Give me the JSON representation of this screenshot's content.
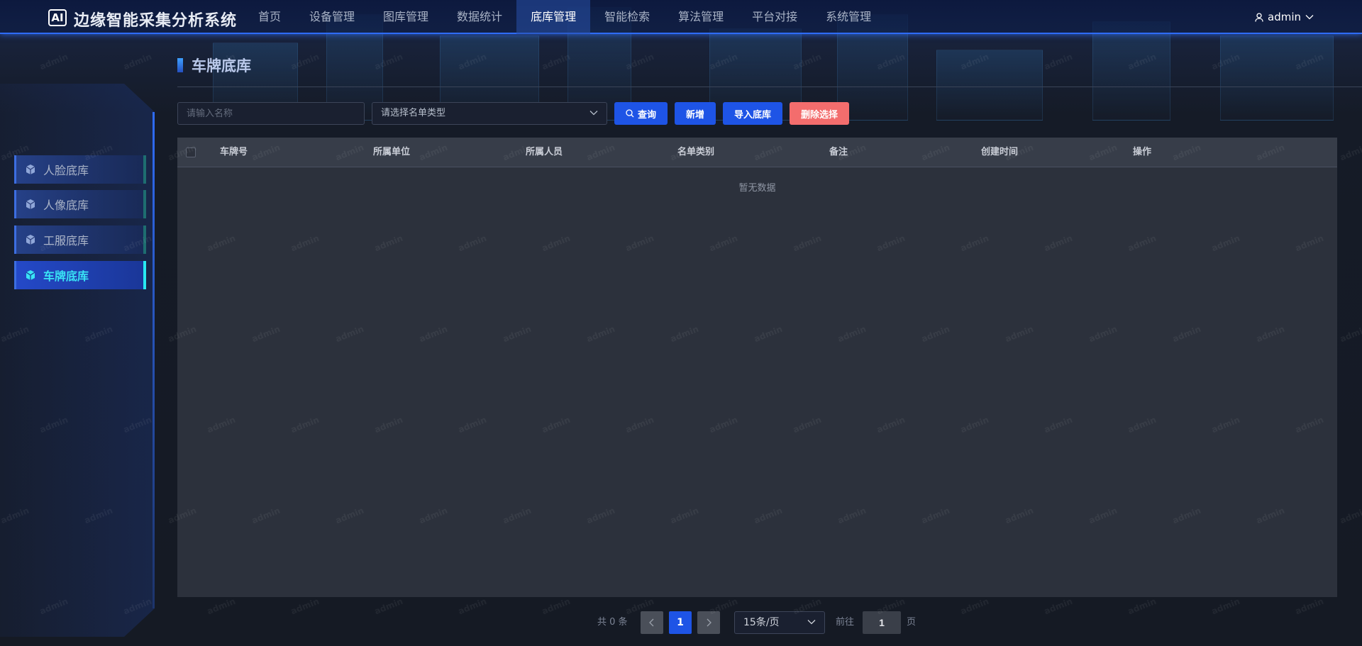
{
  "header": {
    "logo_text": "AI",
    "app_title": "边缘智能采集分析系统",
    "nav": [
      {
        "label": "首页",
        "active": false
      },
      {
        "label": "设备管理",
        "active": false
      },
      {
        "label": "图库管理",
        "active": false
      },
      {
        "label": "数据统计",
        "active": false
      },
      {
        "label": "底库管理",
        "active": true
      },
      {
        "label": "智能检索",
        "active": false
      },
      {
        "label": "算法管理",
        "active": false
      },
      {
        "label": "平台对接",
        "active": false
      },
      {
        "label": "系统管理",
        "active": false
      }
    ],
    "user": "admin"
  },
  "sidebar": {
    "items": [
      {
        "label": "人脸底库",
        "active": false
      },
      {
        "label": "人像底库",
        "active": false
      },
      {
        "label": "工服底库",
        "active": false
      },
      {
        "label": "车牌底库",
        "active": true
      }
    ]
  },
  "main": {
    "title": "车牌底库",
    "search": {
      "placeholder": "请输入名称",
      "value": ""
    },
    "type_select": {
      "value": "请选择名单类型"
    },
    "buttons": {
      "query": "查询",
      "add": "新增",
      "import": "导入底库",
      "delete": "删除选择"
    },
    "table": {
      "columns": [
        "车牌号",
        "所属单位",
        "所属人员",
        "名单类别",
        "备注",
        "创建时间",
        "操作"
      ],
      "rows": [],
      "empty_text": "暂无数据"
    },
    "pagination": {
      "total_text": "共 0 条",
      "current_page": "1",
      "page_size": "15条/页",
      "goto_label": "前往",
      "goto_value": "1",
      "page_suffix": "页"
    }
  },
  "watermark": "admin",
  "colors": {
    "primary": "#1e54e6",
    "danger": "#f36d6d",
    "active_cyan": "#39e3f5",
    "background": "#151a24"
  }
}
